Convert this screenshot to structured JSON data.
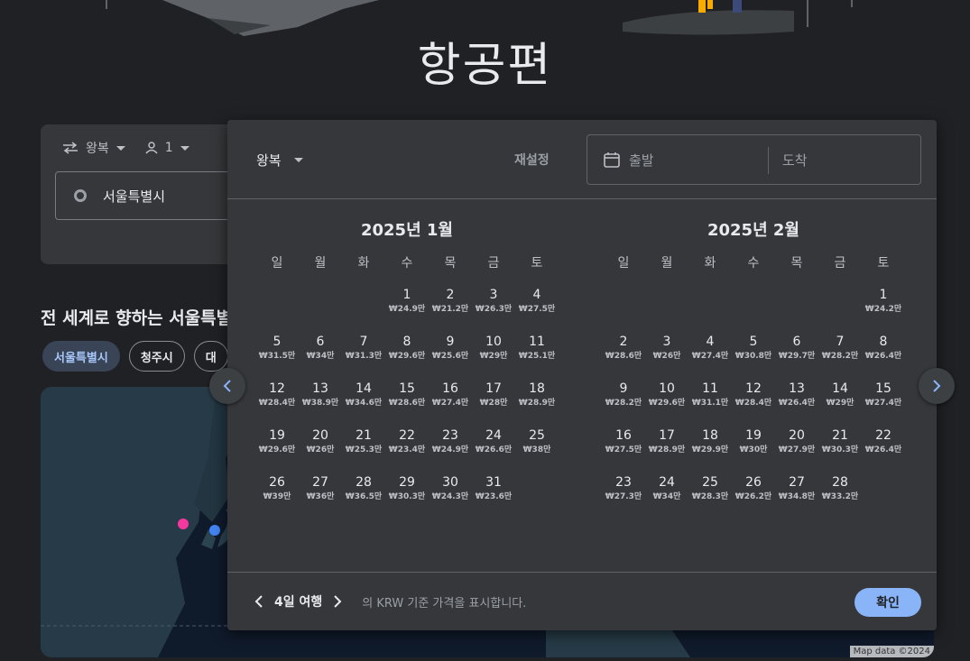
{
  "page": {
    "title": "항공편"
  },
  "search": {
    "trip_type": "왕복",
    "passengers": "1",
    "origin": "서울특별시"
  },
  "explore": {
    "title": "전 세계로 향하는 서울특별시",
    "chips": [
      "서울특별시",
      "청주시",
      "대"
    ]
  },
  "map": {
    "attribution": "Map data ©2024"
  },
  "dialog": {
    "trip_type": "왕복",
    "reset_label": "재설정",
    "depart_placeholder": "출발",
    "return_placeholder": "도착",
    "weekdays": [
      "일",
      "월",
      "화",
      "수",
      "목",
      "금",
      "토"
    ],
    "months": [
      {
        "title": "2025년 1월",
        "lead_blank": 3,
        "days": [
          {
            "d": "1",
            "p": "₩24.9만"
          },
          {
            "d": "2",
            "p": "₩21.2만"
          },
          {
            "d": "3",
            "p": "₩26.3만"
          },
          {
            "d": "4",
            "p": "₩27.5만"
          },
          {
            "d": "5",
            "p": "₩31.5만"
          },
          {
            "d": "6",
            "p": "₩34만"
          },
          {
            "d": "7",
            "p": "₩31.3만"
          },
          {
            "d": "8",
            "p": "₩29.6만"
          },
          {
            "d": "9",
            "p": "₩25.6만"
          },
          {
            "d": "10",
            "p": "₩29만"
          },
          {
            "d": "11",
            "p": "₩25.1만"
          },
          {
            "d": "12",
            "p": "₩28.4만"
          },
          {
            "d": "13",
            "p": "₩38.9만"
          },
          {
            "d": "14",
            "p": "₩34.6만"
          },
          {
            "d": "15",
            "p": "₩28.6만"
          },
          {
            "d": "16",
            "p": "₩27.4만"
          },
          {
            "d": "17",
            "p": "₩28만"
          },
          {
            "d": "18",
            "p": "₩28.9만"
          },
          {
            "d": "19",
            "p": "₩29.6만"
          },
          {
            "d": "20",
            "p": "₩26만"
          },
          {
            "d": "21",
            "p": "₩25.3만"
          },
          {
            "d": "22",
            "p": "₩23.4만"
          },
          {
            "d": "23",
            "p": "₩24.9만"
          },
          {
            "d": "24",
            "p": "₩26.6만"
          },
          {
            "d": "25",
            "p": "₩38만"
          },
          {
            "d": "26",
            "p": "₩39만"
          },
          {
            "d": "27",
            "p": "₩36만"
          },
          {
            "d": "28",
            "p": "₩36.5만"
          },
          {
            "d": "29",
            "p": "₩30.3만"
          },
          {
            "d": "30",
            "p": "₩24.3만"
          },
          {
            "d": "31",
            "p": "₩23.6만"
          }
        ]
      },
      {
        "title": "2025년 2월",
        "lead_blank": 6,
        "days": [
          {
            "d": "1",
            "p": "₩24.2만"
          },
          {
            "d": "2",
            "p": "₩28.6만"
          },
          {
            "d": "3",
            "p": "₩26만"
          },
          {
            "d": "4",
            "p": "₩27.4만"
          },
          {
            "d": "5",
            "p": "₩30.8만"
          },
          {
            "d": "6",
            "p": "₩29.7만"
          },
          {
            "d": "7",
            "p": "₩28.2만"
          },
          {
            "d": "8",
            "p": "₩26.4만"
          },
          {
            "d": "9",
            "p": "₩28.2만"
          },
          {
            "d": "10",
            "p": "₩29.6만"
          },
          {
            "d": "11",
            "p": "₩31.1만"
          },
          {
            "d": "12",
            "p": "₩28.4만"
          },
          {
            "d": "13",
            "p": "₩26.4만"
          },
          {
            "d": "14",
            "p": "₩29만"
          },
          {
            "d": "15",
            "p": "₩27.4만"
          },
          {
            "d": "16",
            "p": "₩27.5만"
          },
          {
            "d": "17",
            "p": "₩28.9만"
          },
          {
            "d": "18",
            "p": "₩29.9만"
          },
          {
            "d": "19",
            "p": "₩30만"
          },
          {
            "d": "20",
            "p": "₩27.9만"
          },
          {
            "d": "21",
            "p": "₩30.3만"
          },
          {
            "d": "22",
            "p": "₩26.4만"
          },
          {
            "d": "23",
            "p": "₩27.3만"
          },
          {
            "d": "24",
            "p": "₩34만"
          },
          {
            "d": "25",
            "p": "₩28.3만"
          },
          {
            "d": "26",
            "p": "₩26.2만"
          },
          {
            "d": "27",
            "p": "₩34.8만"
          },
          {
            "d": "28",
            "p": "₩33.2만"
          }
        ]
      }
    ],
    "footer": {
      "trip_length": "4일 여행",
      "note": "의 KRW 기준 가격을 표시합니다.",
      "confirm_label": "확인"
    }
  },
  "colors": {
    "accent": "#8ab4f8",
    "surface": "#36373a",
    "background": "#202124"
  }
}
